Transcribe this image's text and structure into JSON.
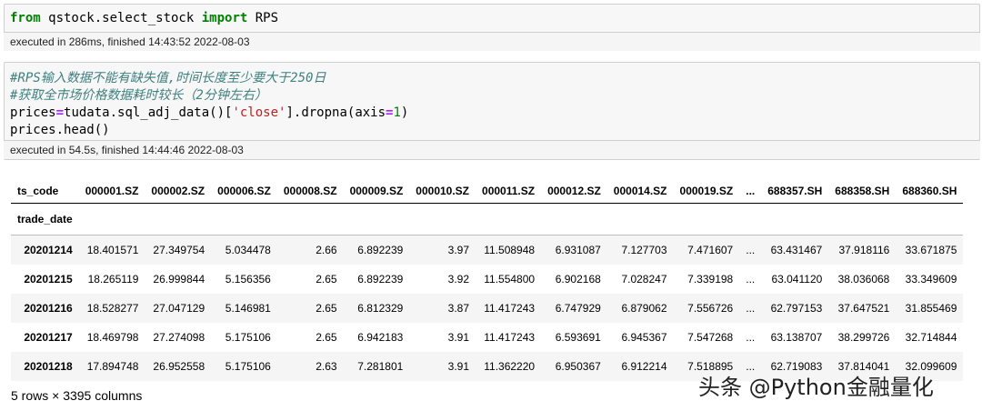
{
  "cell1": {
    "code": {
      "kw_from": "from",
      "module": " qstock.select_stock ",
      "kw_import": "import",
      "name": " RPS"
    },
    "exec": "executed in 286ms, finished 14:43:52 2022-08-03"
  },
  "cell2": {
    "comment1": "#RPS输入数据不能有缺失值,时间长度至少要大于250日",
    "comment2": "#获取全市场价格数据耗时较长（2分钟左右）",
    "line3": {
      "a": "prices",
      "eq": "=",
      "b": "tudata.sql_adj_data()[",
      "s": "'close'",
      "c": "].dropna(axis",
      "eq2": "=",
      "n": "1",
      "d": ")"
    },
    "line4": "prices.head()",
    "exec": "executed in 54.5s, finished 14:44:46 2022-08-03"
  },
  "table": {
    "columns_name": "ts_code",
    "index_name": "trade_date",
    "columns": [
      "000001.SZ",
      "000002.SZ",
      "000006.SZ",
      "000008.SZ",
      "000009.SZ",
      "000010.SZ",
      "000011.SZ",
      "000012.SZ",
      "000014.SZ",
      "000019.SZ",
      "...",
      "688357.SH",
      "688358.SH",
      "688360.SH"
    ],
    "rows": [
      {
        "index": "20201214",
        "values": [
          "18.401571",
          "27.349754",
          "5.034478",
          "2.66",
          "6.892239",
          "3.97",
          "11.508948",
          "6.931087",
          "7.127703",
          "7.471607",
          "...",
          "63.431467",
          "37.918116",
          "33.671875"
        ]
      },
      {
        "index": "20201215",
        "values": [
          "18.265119",
          "26.999844",
          "5.156356",
          "2.65",
          "6.892239",
          "3.92",
          "11.554800",
          "6.902168",
          "7.028247",
          "7.339198",
          "...",
          "63.041120",
          "38.036068",
          "33.349609"
        ]
      },
      {
        "index": "20201216",
        "values": [
          "18.528277",
          "27.047129",
          "5.146981",
          "2.65",
          "6.812329",
          "3.87",
          "11.417243",
          "6.747929",
          "6.879062",
          "7.556726",
          "...",
          "62.797153",
          "37.647521",
          "31.855469"
        ]
      },
      {
        "index": "20201217",
        "values": [
          "18.469798",
          "27.274098",
          "5.175106",
          "2.65",
          "6.942183",
          "3.91",
          "11.417243",
          "6.593691",
          "6.945367",
          "7.547268",
          "...",
          "63.138707",
          "38.299726",
          "32.714844"
        ]
      },
      {
        "index": "20201218",
        "values": [
          "17.894748",
          "26.952558",
          "5.175106",
          "2.63",
          "7.281801",
          "3.91",
          "11.362220",
          "6.950367",
          "6.912214",
          "7.518895",
          "...",
          "62.719083",
          "37.814041",
          "32.099609"
        ]
      }
    ]
  },
  "shape_info": "5 rows × 3395 columns",
  "watermark": "头条 @Python金融量化"
}
